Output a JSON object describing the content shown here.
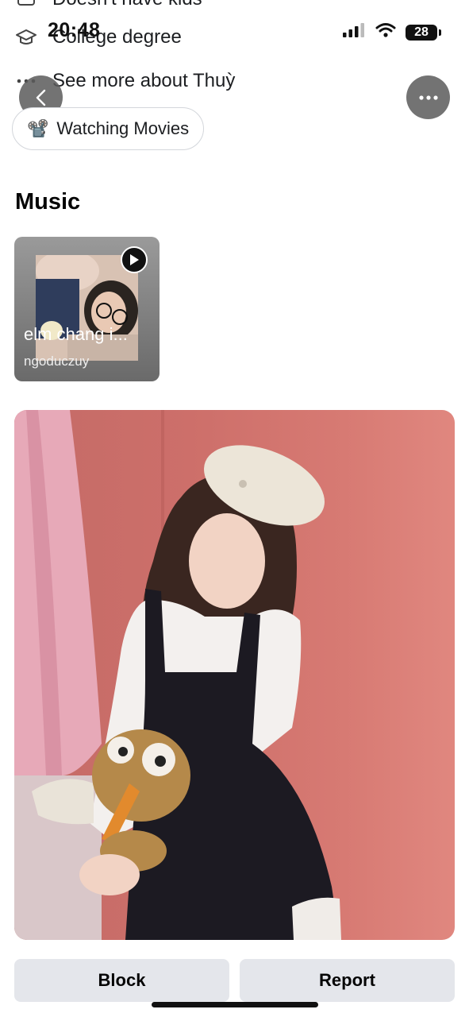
{
  "status_bar": {
    "time": "20:48",
    "battery": "28"
  },
  "details": {
    "partial_top": "Doesn't have kids",
    "education": "College degree",
    "see_more": "See more about Thuỳ"
  },
  "interests": [
    {
      "emoji": "📽️",
      "label": "Watching Movies"
    }
  ],
  "music": {
    "section_title": "Music",
    "track": {
      "title": "elm chang i...",
      "artist": "ngoduczuy"
    }
  },
  "actions": {
    "block": "Block",
    "report": "Report"
  }
}
